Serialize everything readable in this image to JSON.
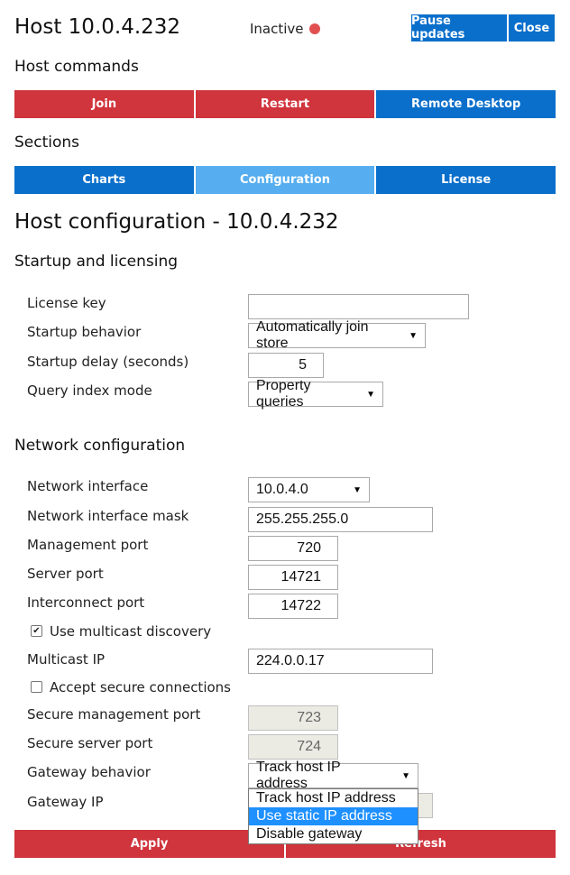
{
  "header": {
    "title": "Host 10.0.4.232",
    "status": "Inactive",
    "status_color": "#e05050",
    "pause_label": "Pause updates",
    "close_label": "Close"
  },
  "colors": {
    "red": "#d0343c",
    "blue": "#0a6fcb",
    "light_blue": "#56aef0",
    "highlight": "#1e90ff"
  },
  "host_commands": {
    "title": "Host commands",
    "items": [
      "Join",
      "Restart",
      "Remote Desktop"
    ]
  },
  "sections": {
    "title": "Sections",
    "items": [
      "Charts",
      "Configuration",
      "License"
    ],
    "active": "Configuration"
  },
  "config": {
    "title": "Host configuration - 10.0.4.232",
    "startup": {
      "title": "Startup and licensing",
      "license_key_label": "License key",
      "license_key_value": "",
      "startup_behavior_label": "Startup behavior",
      "startup_behavior_value": "Automatically join store",
      "startup_delay_label": "Startup delay (seconds)",
      "startup_delay_value": "5",
      "query_index_label": "Query index mode",
      "query_index_value": "Property queries"
    },
    "network": {
      "title": "Network configuration",
      "interface_label": "Network interface",
      "interface_value": "10.0.4.0",
      "mask_label": "Network interface mask",
      "mask_value": "255.255.255.0",
      "mgmt_port_label": "Management port",
      "mgmt_port_value": "720",
      "server_port_label": "Server port",
      "server_port_value": "14721",
      "interconnect_label": "Interconnect port",
      "interconnect_value": "14722",
      "multicast_discovery_label": "Use multicast discovery",
      "multicast_discovery_checked": true,
      "multicast_ip_label": "Multicast IP",
      "multicast_ip_value": "224.0.0.17",
      "secure_conn_label": "Accept secure connections",
      "secure_conn_checked": false,
      "secure_mgmt_label": "Secure management port",
      "secure_mgmt_value": "723",
      "secure_server_label": "Secure server port",
      "secure_server_value": "724",
      "gateway_behavior_label": "Gateway behavior",
      "gateway_behavior_value": "Track host IP address",
      "gateway_options": [
        "Track host IP address",
        "Use static IP address",
        "Disable gateway"
      ],
      "gateway_highlighted": "Use static IP address",
      "gateway_ip_label": "Gateway IP"
    }
  },
  "actions": {
    "apply_label": "Apply",
    "refresh_label": "Refresh"
  }
}
